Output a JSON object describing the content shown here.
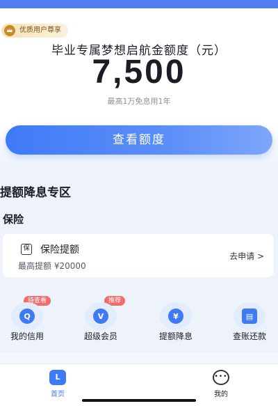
{
  "hero": {
    "badge": "优质用户尊享",
    "title": "毕业专属梦想启航金额度（元）",
    "amount": "7,500",
    "subtitle": "最高1万免息用1年",
    "cta": "查看额度"
  },
  "section": {
    "title": "提额降息专区",
    "subtitle": "保险"
  },
  "card": {
    "icon_glyph": "保",
    "title": "保险提额",
    "sub": "最高提额 ¥20000",
    "link": "去申请 >"
  },
  "actions": [
    {
      "label": "我的信用",
      "tag": "待查看",
      "icon": "magnifier-icon",
      "glyph": "Q"
    },
    {
      "label": "超级会员",
      "tag": "推荐",
      "icon": "crown-icon",
      "glyph": "V"
    },
    {
      "label": "提额降息",
      "tag": "",
      "icon": "yen-icon",
      "glyph": "¥"
    },
    {
      "label": "查账还款",
      "tag": "",
      "icon": "calendar-icon",
      "glyph": "▤"
    }
  ],
  "tabs": [
    {
      "label": "首页",
      "icon": "home-icon",
      "glyph": "L"
    },
    {
      "label": "我的",
      "icon": "chat-icon",
      "glyph": "•••"
    }
  ],
  "colors": {
    "accent": "#3f7af6",
    "tag_red": "#f36c6c",
    "badge_gold": "#c88b2b"
  }
}
